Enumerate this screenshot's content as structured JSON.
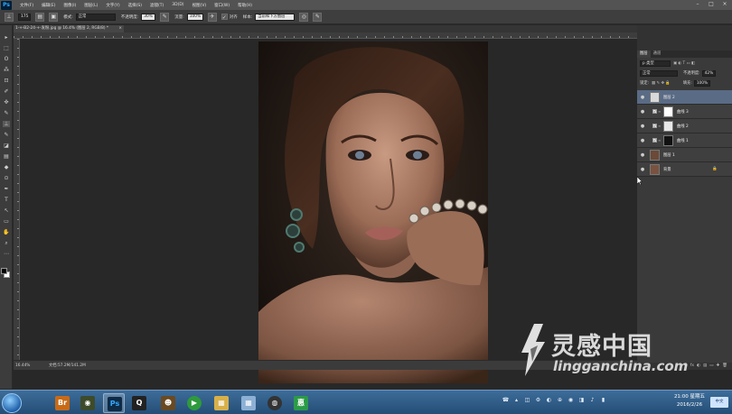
{
  "menubar": {
    "logo": "Ps",
    "items": [
      "文件(F)",
      "编辑(E)",
      "图像(I)",
      "图层(L)",
      "文字(Y)",
      "选择(S)",
      "滤镜(T)",
      "3D(D)",
      "视图(V)",
      "窗口(W)",
      "帮助(H)"
    ],
    "window_controls": [
      "–",
      "□",
      "×"
    ]
  },
  "options_bar": {
    "tool_glyph": "⊥",
    "brush_size": "175",
    "mode_label": "模式:",
    "mode_value": "正常",
    "opacity_label": "不透明度:",
    "opacity_value": "30%",
    "flow_label": "流量:",
    "flow_value": "100%",
    "align_label": "对齐",
    "sample_label": "样本:",
    "sample_value": "当前和下方图层"
  },
  "document": {
    "tab_label": "1-+-B2-24-+-发粉.jpg @ 16.4% (图层 2, RGB/8) *",
    "close": "×",
    "zoom": "16.44%",
    "doc_info": "文档:57.2M/141.2M"
  },
  "tools": [
    "▸",
    "⬚",
    "ʘ",
    "⁂",
    "⊡",
    "✐",
    "✜",
    "✎",
    "⊥",
    "✎",
    "◪",
    "▤",
    "◆",
    "⊙",
    "✒",
    "T",
    "↖",
    "▭",
    "✋",
    "⌕",
    "⋯"
  ],
  "layers_panel": {
    "tabs": [
      "图层",
      "通道"
    ],
    "kind_label": "p 类型",
    "blend_mode": "正常",
    "opacity_label": "不透明度:",
    "opacity_value": "42%",
    "lock_label": "锁定:",
    "fill_label": "填充:",
    "fill_value": "100%",
    "layers": [
      {
        "name": "图层 2",
        "active": true,
        "visible": "●",
        "check": "",
        "link": "",
        "thumb_color": "#d9d9d9"
      },
      {
        "name": "曲线 3",
        "active": false,
        "visible": "●",
        "check": "✓",
        "link": "∞",
        "thumb_color": "#ffffff"
      },
      {
        "name": "曲线 2",
        "active": false,
        "visible": "●",
        "check": "✓",
        "link": "∞",
        "thumb_color": "#e8e8e8"
      },
      {
        "name": "曲线 1",
        "active": false,
        "visible": "●",
        "check": "✓",
        "link": "∞",
        "thumb_color": "#111111"
      },
      {
        "name": "图层 1",
        "active": false,
        "visible": "●",
        "check": "",
        "link": "",
        "thumb_color": "#6b4a38"
      },
      {
        "name": "背景",
        "active": false,
        "visible": "●",
        "check": "",
        "link": "",
        "thumb_color": "#7a5240",
        "lock": "🔒"
      }
    ],
    "footer_icons": [
      "ʘ",
      "fx",
      "◐",
      "▤",
      "▭",
      "✚",
      "🗑"
    ]
  },
  "watermark": {
    "cn": "灵感中国",
    "en": "lingganchina.com"
  },
  "taskbar": {
    "apps": [
      {
        "glyph": "Br",
        "color": "#c86a16"
      },
      {
        "glyph": "◉",
        "color": "#3d4b2a"
      },
      {
        "glyph": "Ps",
        "color": "#0f2a45"
      },
      {
        "glyph": "Q",
        "color": "#222222"
      },
      {
        "glyph": "☻",
        "color": "#6a4a22"
      },
      {
        "glyph": "▶",
        "color": "#2e9a3c"
      },
      {
        "glyph": "▦",
        "color": "#d7b04a"
      },
      {
        "glyph": "◍",
        "color": "#333333"
      },
      {
        "glyph": "惠",
        "color": "#2b9b47"
      }
    ],
    "tray_icons": [
      "☎",
      "▴",
      "◫",
      "⚙",
      "◐",
      "⊕",
      "◉",
      "◨",
      "♪",
      "▮"
    ],
    "time": "21:00 星期五",
    "date": "2016/2/26",
    "lang": "中文"
  }
}
